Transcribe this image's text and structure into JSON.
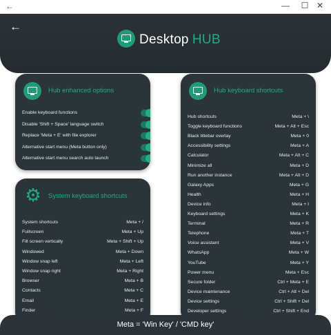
{
  "window": {
    "back_icon": "arrow-left-icon",
    "controls": {
      "minimize": "—",
      "maximize": "☐",
      "close": "✕"
    }
  },
  "header": {
    "back_icon": "arrow-left-icon",
    "brand_primary": "Desktop",
    "brand_accent": "HUB",
    "accent_color": "#1fae86",
    "background": "#2b3338"
  },
  "enhanced": {
    "title": "Hub enhanced options",
    "options": [
      {
        "label": "Enable keyboard functions",
        "enabled": true
      },
      {
        "label": "Disable 'Shift + Space' language switch",
        "enabled": true
      },
      {
        "label": "Replace 'Meta + E' with file explorer",
        "enabled": true
      },
      {
        "label": "Alternative start menu (Meta button only)",
        "enabled": true
      },
      {
        "label": "Alternative start menu search auto launch",
        "enabled": true
      }
    ]
  },
  "system": {
    "title": "System keyboard shortcuts",
    "shortcuts": [
      {
        "label": "System shortcuts",
        "keys": "Meta + /"
      },
      {
        "label": "Fullscreen",
        "keys": "Meta + Up"
      },
      {
        "label": "Fill screen vertically",
        "keys": "Meta + Shift + Up"
      },
      {
        "label": "Windowed",
        "keys": "Meta + Down"
      },
      {
        "label": "Window snap left",
        "keys": "Meta + Left"
      },
      {
        "label": "Window snap right",
        "keys": "Meta + Right"
      },
      {
        "label": "Browser",
        "keys": "Meta + B"
      },
      {
        "label": "Contacts",
        "keys": "Meta + C"
      },
      {
        "label": "Email",
        "keys": "Meta + E"
      },
      {
        "label": "Finder",
        "keys": "Meta + F"
      }
    ]
  },
  "hub": {
    "title": "Hub keyboard shortcuts",
    "shortcuts": [
      {
        "label": "Hub shortcuts",
        "keys": "Meta + \\"
      },
      {
        "label": "Toggle keyboard functions",
        "keys": "Meta + Alt + Esc"
      },
      {
        "label": "Black titlebar overlay",
        "keys": "Meta + 0"
      },
      {
        "label": "Accessibility settings",
        "keys": "Meta + A"
      },
      {
        "label": "Calculator",
        "keys": "Meta + Alt + C"
      },
      {
        "label": "Minimize all",
        "keys": "Meta + D"
      },
      {
        "label": "Run another instance",
        "keys": "Meta + Alt + D"
      },
      {
        "label": "Galaxy Apps",
        "keys": "Meta + G"
      },
      {
        "label": "Health",
        "keys": "Meta + H"
      },
      {
        "label": "Device info",
        "keys": "Meta + I"
      },
      {
        "label": "Keyboard settings",
        "keys": "Meta + K"
      },
      {
        "label": "Terminal",
        "keys": "Meta + R"
      },
      {
        "label": "Telephone",
        "keys": "Meta + T"
      },
      {
        "label": "Voice assistant",
        "keys": "Meta + V"
      },
      {
        "label": "WhatsApp",
        "keys": "Meta + W"
      },
      {
        "label": "YouTube",
        "keys": "Meta + Y"
      },
      {
        "label": "Power menu",
        "keys": "Meta + Esc"
      },
      {
        "label": "Secure folder",
        "keys": "Ctrl + Meta + E"
      },
      {
        "label": "Device maintenance",
        "keys": "Ctrl + Alt + Del"
      },
      {
        "label": "Device settings",
        "keys": "Ctrl + Shift + Del"
      },
      {
        "label": "Developer settings",
        "keys": "Ctrl + Shift + End"
      }
    ]
  },
  "footer": {
    "note": "Meta = 'Win Key' / 'CMD key'"
  }
}
